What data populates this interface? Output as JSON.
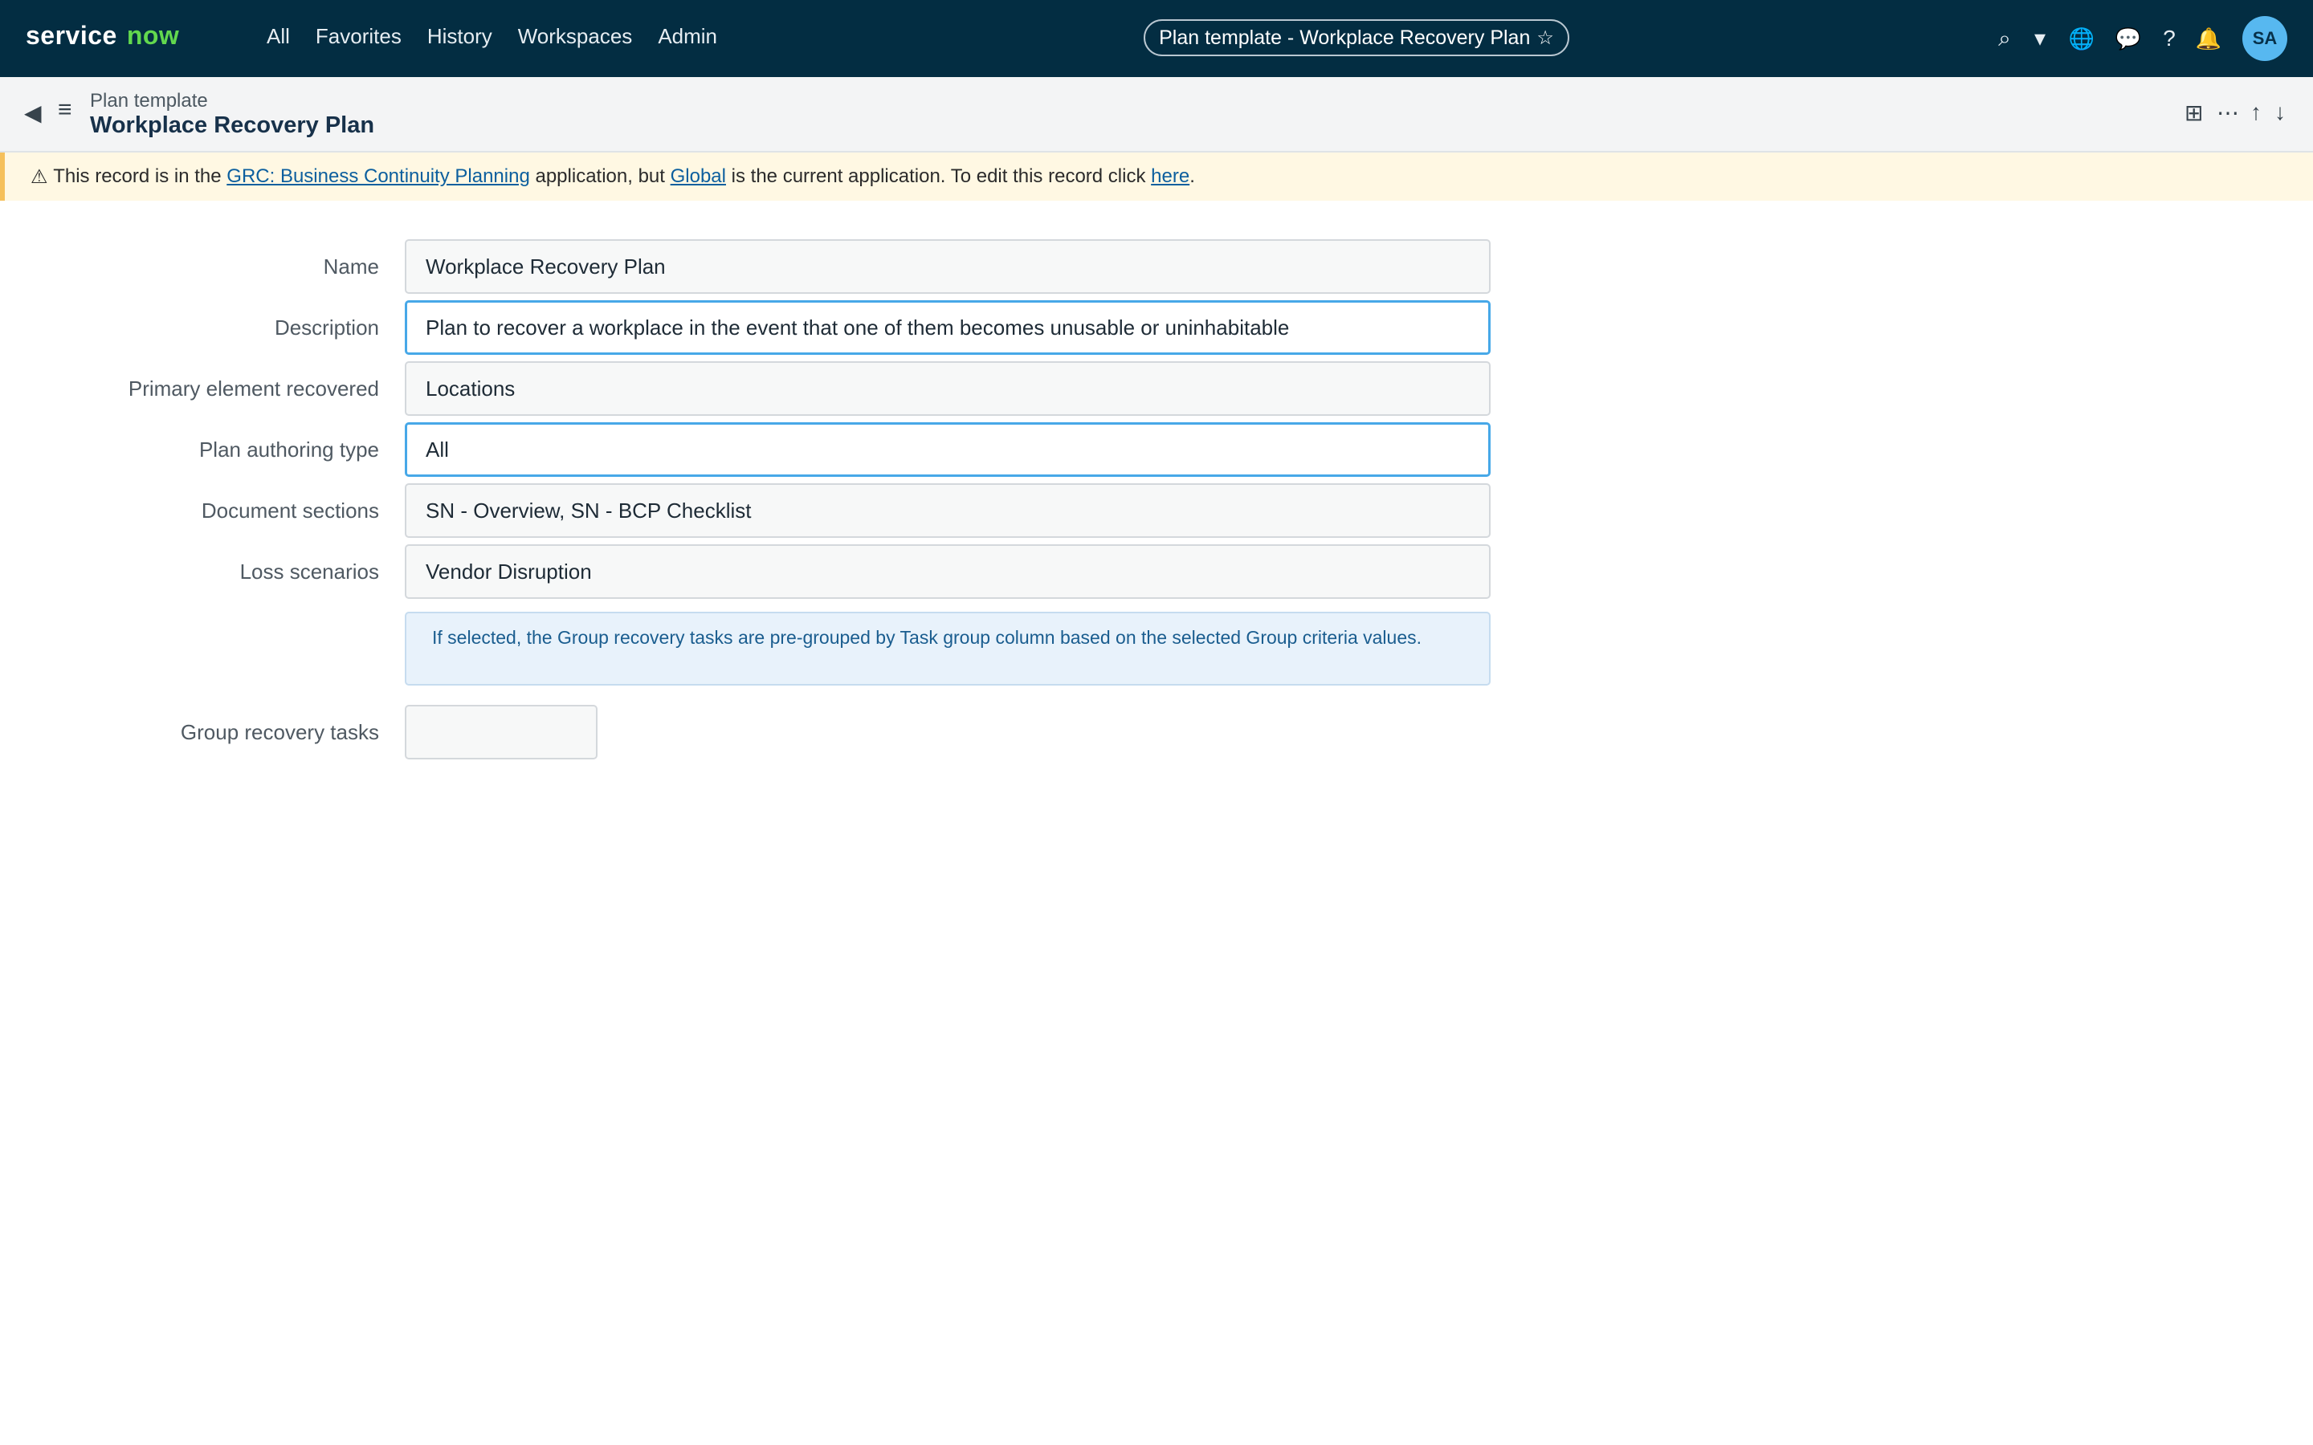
{
  "topbar": {
    "logo_part1": "service",
    "logo_part2": "now",
    "nav": [
      "All",
      "Favorites",
      "History",
      "Workspaces",
      "Admin"
    ],
    "context_title": "Plan template - Workplace Recovery Plan",
    "context_star": "☆",
    "icons": {
      "search": "⌕",
      "dropdown": "▾",
      "globe": "🌐",
      "chat": "💬",
      "help": "?",
      "bell": "🔔"
    },
    "avatar_initials": "SA"
  },
  "subheader": {
    "back_icon": "◀",
    "menu_icon": "≡",
    "record_type": "Plan template",
    "record_title": "Workplace Recovery Plan",
    "right_icons": {
      "layout": "⊞",
      "more": "⋯",
      "up": "↑",
      "down": "↓"
    }
  },
  "banner": {
    "icon": "⚠",
    "text1": "This record is in the",
    "link1": "GRC: Business Continuity Planning",
    "text2": "application, but",
    "link2": "Global",
    "text3": "is the current application. To edit this record click",
    "link3": "here",
    "text4": "."
  },
  "form": {
    "fields": [
      {
        "label": "Name",
        "value": "Workplace Recovery Plan"
      },
      {
        "label": "Description",
        "value": "Plan to recover a workplace in the event that one of them becomes unusable or uninhabitable"
      },
      {
        "label": "Primary element recovered",
        "value": "Locations"
      },
      {
        "label": "Plan authoring type",
        "value": "All"
      },
      {
        "label": "Document sections",
        "value": "SN - Overview, SN - BCP Checklist"
      },
      {
        "label": "Loss scenarios",
        "value": "Vendor Disruption"
      }
    ],
    "info_message": "If selected, the Group recovery tasks are pre-grouped by Task group column based on the selected Group criteria values.",
    "group_recovery": {
      "label": "Group recovery tasks",
      "value": ""
    }
  }
}
